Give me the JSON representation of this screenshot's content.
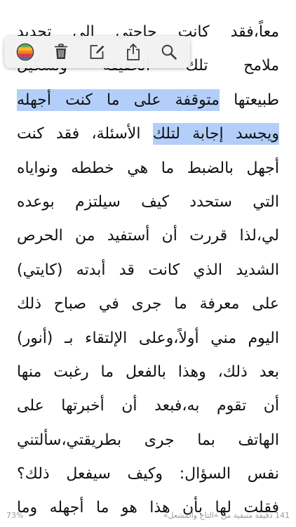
{
  "page": {
    "lines": [
      {
        "text": "معاً،فقد كانت حاجتي الى تحديد"
      },
      {
        "text": "ملامح تلك الحقيقة وتشكيل"
      },
      {
        "before": "طبيعتها ",
        "highlight": "متوقفة على ما كنت أجهله"
      },
      {
        "highlight": "ويجسد إجابة لتلك",
        "after": " الأسئلة، فقد كنت"
      },
      {
        "text": "أجهل بالضبط ما هي خططه ونواياه"
      },
      {
        "text": "التي ستحدد كيف سيلتزم بوعده"
      },
      {
        "text": "لي،لذا قررت أن أستفيد من الحرص"
      },
      {
        "text": "الشديد الذي كانت قد أبدته (كايتي)"
      },
      {
        "text": "على معرفة ما جرى في صباح ذلك"
      },
      {
        "text": "اليوم مني أولاً،وعلى الإلتقاء بـ (أنور)"
      },
      {
        "text": "بعد ذلك، وهذا بالفعل ما رغبت منها"
      },
      {
        "text": "أن تقوم به،فبعد أن أخبرتها على"
      },
      {
        "text": "الهاتف بما جرى بطريقتي،سألتني"
      },
      {
        "text": "نفس السؤال: وكيف سيفعل ذلك؟"
      },
      {
        "text": "فقلت لها بأن هذا هو ما أجهله وما"
      }
    ]
  },
  "toolbar": {
    "tools": [
      {
        "name": "color-picker",
        "icon": "color-circle-icon"
      },
      {
        "name": "delete",
        "icon": "trash-icon"
      },
      {
        "name": "note",
        "icon": "note-edit-icon"
      },
      {
        "name": "share",
        "icon": "share-icon"
      },
      {
        "name": "search",
        "icon": "magnifier-icon"
      }
    ]
  },
  "footer": {
    "progress_label": "73%",
    "remaining_label": "141 دقيقة متبقية من «التاج والمشعل»"
  },
  "colors": {
    "highlight": "#b3cff9",
    "text": "#111111",
    "footer_text": "#9a9a9a",
    "toolbar_bg": "#f2f2f2",
    "icon": "#3a3a3a"
  }
}
